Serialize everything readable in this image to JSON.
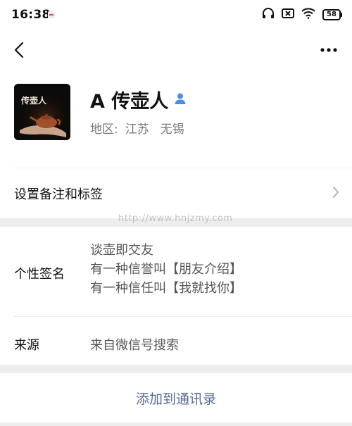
{
  "status_bar": {
    "time": "16:38",
    "battery": "58",
    "icons": [
      "notification-badge-icon",
      "headphones-icon",
      "no-sim-icon",
      "wifi-icon",
      "battery-icon"
    ]
  },
  "nav": {
    "icons": [
      "back-arrow-icon",
      "more-dots-icon"
    ]
  },
  "profile": {
    "name": "A 传壶人",
    "region_label": "地区:",
    "region_province": "江苏",
    "region_city": "无锡",
    "avatar_text": "传壶人",
    "icons": [
      "contact-person-icon"
    ],
    "accent_color": "#4a90e2"
  },
  "remark_row": {
    "label": "设置备注和标签",
    "icon": "chevron-right-icon"
  },
  "watermark": "http://www.hnjzmy.com",
  "signature": {
    "label": "个性签名",
    "lines": [
      "谈壶即交友",
      "有一种信誉叫【朋友介绍】",
      "有一种信任叫【我就找你】"
    ]
  },
  "source": {
    "label": "来源",
    "value": "来自微信号搜索"
  },
  "action": {
    "label": "添加到通讯录",
    "color": "#576b95"
  }
}
